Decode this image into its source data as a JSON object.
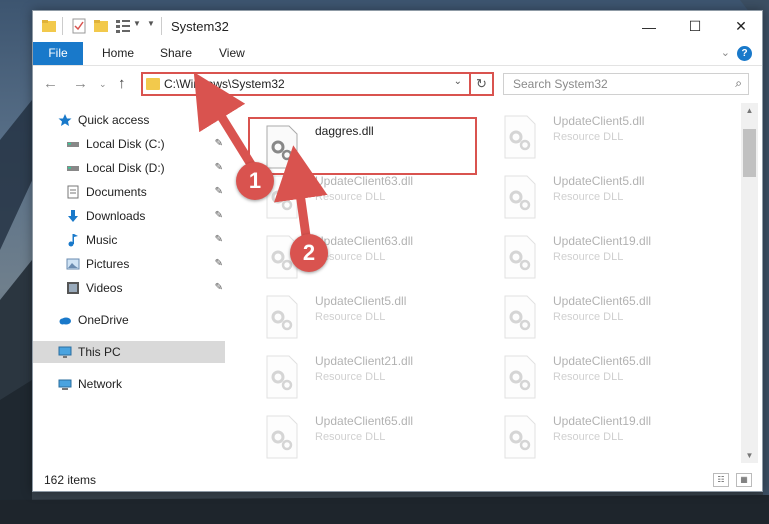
{
  "window": {
    "title": "System32",
    "minimize": "—",
    "maximize": "☐",
    "close": "✕"
  },
  "ribbon": {
    "tabs": [
      "File",
      "Home",
      "Share",
      "View"
    ],
    "help": "?",
    "collapse": "⌄"
  },
  "address": {
    "path": "C:\\Windows\\System32",
    "dropdown": "⌄",
    "refresh": "↻",
    "back": "←",
    "forward": "→",
    "recent": "⌄",
    "up": "↑"
  },
  "search": {
    "placeholder": "Search System32",
    "icon": "⌕"
  },
  "nav": {
    "items": [
      {
        "label": "Quick access",
        "icon": "star-icon",
        "pinned": false
      },
      {
        "label": "Local Disk (C:)",
        "icon": "drive-icon",
        "pinned": true
      },
      {
        "label": "Local Disk (D:)",
        "icon": "drive-icon",
        "pinned": true
      },
      {
        "label": "Documents",
        "icon": "documents-icon",
        "pinned": true
      },
      {
        "label": "Downloads",
        "icon": "download-icon",
        "pinned": true
      },
      {
        "label": "Music",
        "icon": "music-icon",
        "pinned": true
      },
      {
        "label": "Pictures",
        "icon": "pictures-icon",
        "pinned": true
      },
      {
        "label": "Videos",
        "icon": "videos-icon",
        "pinned": true
      },
      {
        "label": "OneDrive",
        "icon": "cloud-icon",
        "pinned": false
      },
      {
        "label": "This PC",
        "icon": "computer-icon",
        "pinned": false,
        "selected": true
      },
      {
        "label": "Network",
        "icon": "network-icon",
        "pinned": false
      }
    ],
    "pin_glyph": "📌"
  },
  "files": [
    {
      "name": "daggres.dll",
      "type": "",
      "faded": false
    },
    {
      "name": "UpdateClient5.dll",
      "type": "Resource DLL",
      "faded": true
    },
    {
      "name": "UpdateClient63.dll",
      "type": "Resource DLL",
      "faded": true
    },
    {
      "name": "UpdateClient5.dll",
      "type": "Resource DLL",
      "faded": true
    },
    {
      "name": "UpdateClient63.dll",
      "type": "Resource DLL",
      "faded": true
    },
    {
      "name": "UpdateClient19.dll",
      "type": "Resource DLL",
      "faded": true
    },
    {
      "name": "UpdateClient5.dll",
      "type": "Resource DLL",
      "faded": true
    },
    {
      "name": "UpdateClient65.dll",
      "type": "Resource DLL",
      "faded": true
    },
    {
      "name": "UpdateClient21.dll",
      "type": "Resource DLL",
      "faded": true
    },
    {
      "name": "UpdateClient65.dll",
      "type": "Resource DLL",
      "faded": true
    },
    {
      "name": "UpdateClient65.dll",
      "type": "Resource DLL",
      "faded": true
    },
    {
      "name": "UpdateClient19.dll",
      "type": "Resource DLL",
      "faded": true
    }
  ],
  "status": {
    "count": "162 items",
    "view_details": "☷",
    "view_icons": "▦"
  },
  "annotations": {
    "step1": "1",
    "step2": "2"
  },
  "colors": {
    "accent": "#1979ca",
    "highlight": "#d9534f",
    "folder": "#f2c94c"
  }
}
